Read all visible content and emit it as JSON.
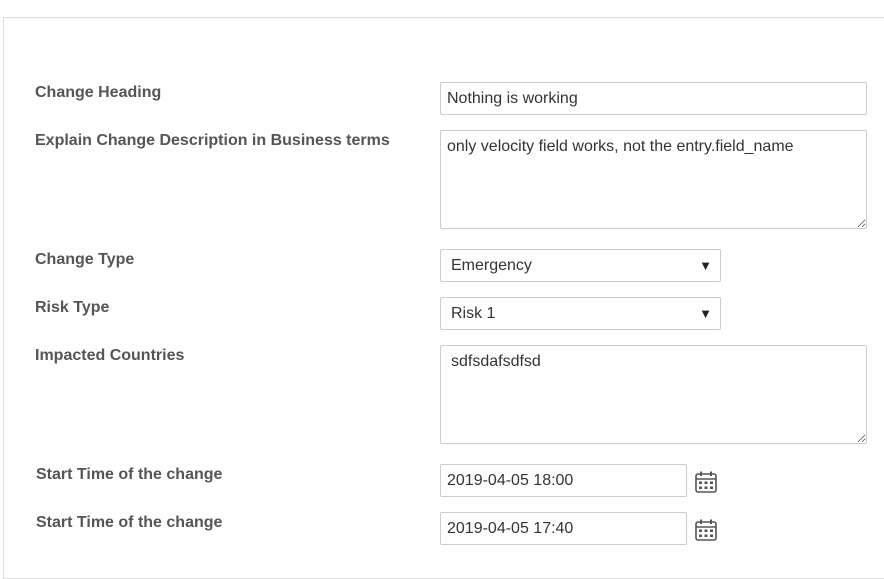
{
  "form": {
    "change_heading": {
      "label": "Change Heading",
      "value": "Nothing is working"
    },
    "description": {
      "label": "Explain Change Description in Business terms",
      "value": "only velocity field works, not the entry.field_name"
    },
    "change_type": {
      "label": "Change Type",
      "selected": "Emergency"
    },
    "risk_type": {
      "label": "Risk Type",
      "selected": "Risk 1"
    },
    "impacted_countries": {
      "label": "Impacted Countries",
      "value": "sdfsdafsdfsd"
    },
    "start_time_1": {
      "label": "Start Time of the change",
      "value": "2019-04-05 18:00",
      "icon": "calendar-icon"
    },
    "start_time_2": {
      "label": "Start Time of the change",
      "value": "2019-04-05 17:40",
      "icon": "calendar-icon"
    }
  },
  "icons": {
    "dropdown_arrow": "▼"
  }
}
